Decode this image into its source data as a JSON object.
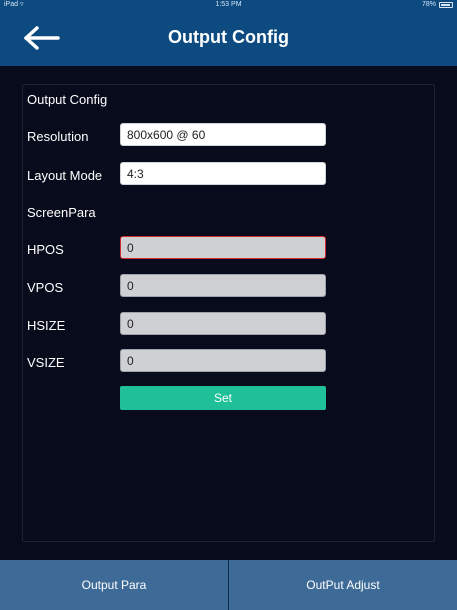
{
  "status_bar": {
    "carrier": "iPad",
    "wifi_icon": "wifi-icon",
    "time": "1:53 PM",
    "battery_text": "78%",
    "battery_icon": "battery-icon"
  },
  "nav": {
    "back_icon": "arrow-left-icon",
    "title": "Output Config"
  },
  "form": {
    "section_title": "Output Config",
    "resolution_label": "Resolution",
    "resolution_value": "800x600 @ 60",
    "layout_mode_label": "Layout Mode",
    "layout_mode_value": "4:3",
    "screen_para_label": "ScreenPara",
    "hpos_label": "HPOS",
    "hpos_value": "0",
    "vpos_label": "VPOS",
    "vpos_value": "0",
    "hsize_label": "HSIZE",
    "hsize_value": "0",
    "vsize_label": "VSIZE",
    "vsize_value": "0",
    "set_label": "Set"
  },
  "tabs": [
    {
      "label": "Output Para"
    },
    {
      "label": "OutPut Adjust"
    }
  ],
  "colors": {
    "nav_bg": "#0c4a80",
    "page_bg": "#070b1b",
    "tab_bg": "#3d6a96",
    "set_button": "#1fbf97",
    "focus_border": "#d22b2b"
  }
}
